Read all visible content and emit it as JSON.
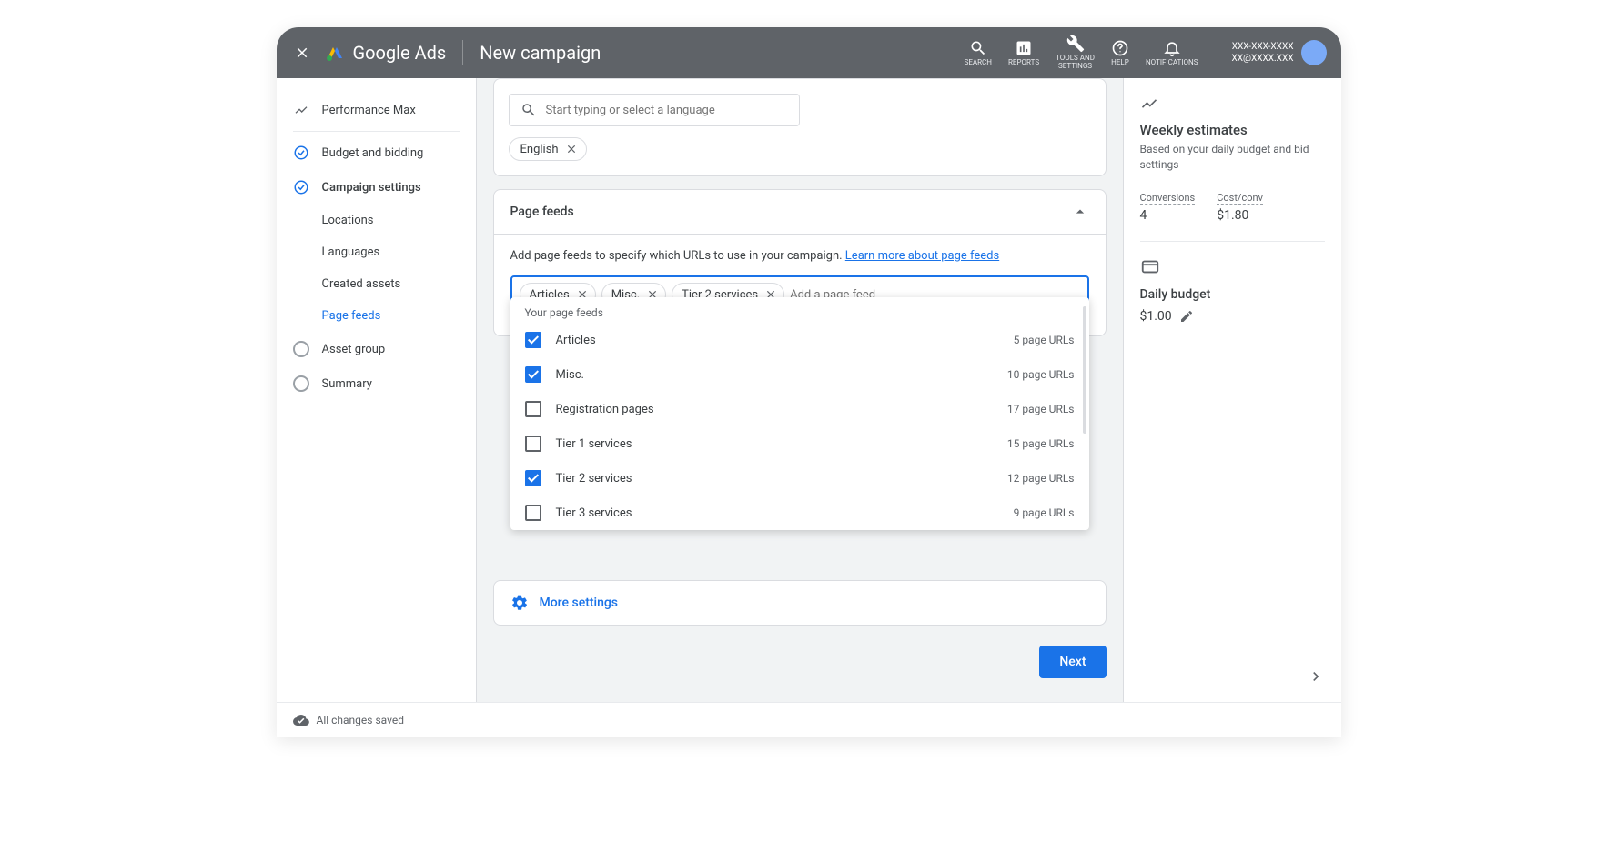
{
  "header": {
    "product": "Google Ads",
    "title": "New campaign",
    "actions": {
      "search": "SEARCH",
      "reports": "REPORTS",
      "tools": "TOOLS AND\nSETTINGS",
      "help": "HELP",
      "notifications": "NOTIFICATIONS"
    },
    "account": {
      "line1": "XXX-XXX-XXXX",
      "line2": "XX@XXXX.XXX"
    }
  },
  "sidebar": {
    "pmax": "Performance Max",
    "budget": "Budget and bidding",
    "settings": "Campaign settings",
    "locations": "Locations",
    "languages": "Languages",
    "created_assets": "Created assets",
    "page_feeds": "Page feeds",
    "asset_group": "Asset group",
    "summary": "Summary"
  },
  "language": {
    "placeholder": "Start typing or select a language",
    "chip": "English"
  },
  "feeds": {
    "title": "Page feeds",
    "desc": "Add page feeds to specify which URLs to use in your campaign. ",
    "learn_more": "Learn more about page feeds",
    "input_placeholder": "Add a page feed",
    "selected": [
      "Articles",
      "Misc.",
      "Tier 2 services"
    ],
    "dropdown_header": "Your page feeds",
    "items": [
      {
        "label": "Articles",
        "count": "5 page URLs",
        "checked": true
      },
      {
        "label": "Misc.",
        "count": "10 page URLs",
        "checked": true
      },
      {
        "label": "Registration pages",
        "count": "17 page URLs",
        "checked": false
      },
      {
        "label": "Tier 1 services",
        "count": "15 page URLs",
        "checked": false
      },
      {
        "label": "Tier 2 services",
        "count": "12 page URLs",
        "checked": true
      },
      {
        "label": "Tier 3 services",
        "count": "9 page URLs",
        "checked": false
      }
    ]
  },
  "more_settings": "More settings",
  "next": "Next",
  "estimates": {
    "title": "Weekly estimates",
    "sub": "Based on your daily budget and bid settings",
    "conversions_label": "Conversions",
    "conversions_val": "4",
    "cost_label": "Cost/conv",
    "cost_val": "$1.80",
    "budget_title": "Daily budget",
    "budget_val": "$1.00"
  },
  "footer": "All changes saved"
}
